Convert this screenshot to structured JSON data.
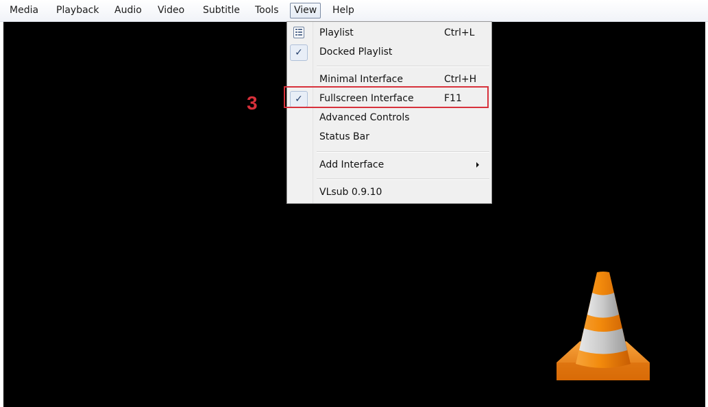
{
  "menubar": {
    "items": [
      {
        "label": "Media"
      },
      {
        "label": "Playback"
      },
      {
        "label": "Audio"
      },
      {
        "label": "Video"
      },
      {
        "label": "Subtitle"
      },
      {
        "label": "Tools"
      },
      {
        "label": "View"
      },
      {
        "label": "Help"
      }
    ],
    "active_item": "View"
  },
  "view_menu": {
    "items": [
      {
        "label": "Playlist",
        "shortcut": "Ctrl+L",
        "icon": "playlist-icon",
        "checked": false
      },
      {
        "label": "Docked Playlist",
        "shortcut": "",
        "checked": true
      },
      {
        "label": "Minimal Interface",
        "shortcut": "Ctrl+H",
        "checked": false
      },
      {
        "label": "Fullscreen Interface",
        "shortcut": "F11",
        "checked": true
      },
      {
        "label": "Advanced Controls",
        "shortcut": "",
        "checked": false
      },
      {
        "label": "Status Bar",
        "shortcut": "",
        "checked": false
      },
      {
        "label": "Add Interface",
        "shortcut": "",
        "has_submenu": true
      },
      {
        "label": "VLsub 0.9.10",
        "shortcut": ""
      }
    ],
    "check_glyph": "✓"
  },
  "annotation": {
    "step_number": "3",
    "color": "#d7303a"
  },
  "colors": {
    "video_background": "#000000",
    "menu_background": "#f0f0f0",
    "cone_orange": "#f28a0c",
    "cone_stripe": "#c9c9c9"
  },
  "icons": {
    "logo": "vlc-cone-logo"
  }
}
